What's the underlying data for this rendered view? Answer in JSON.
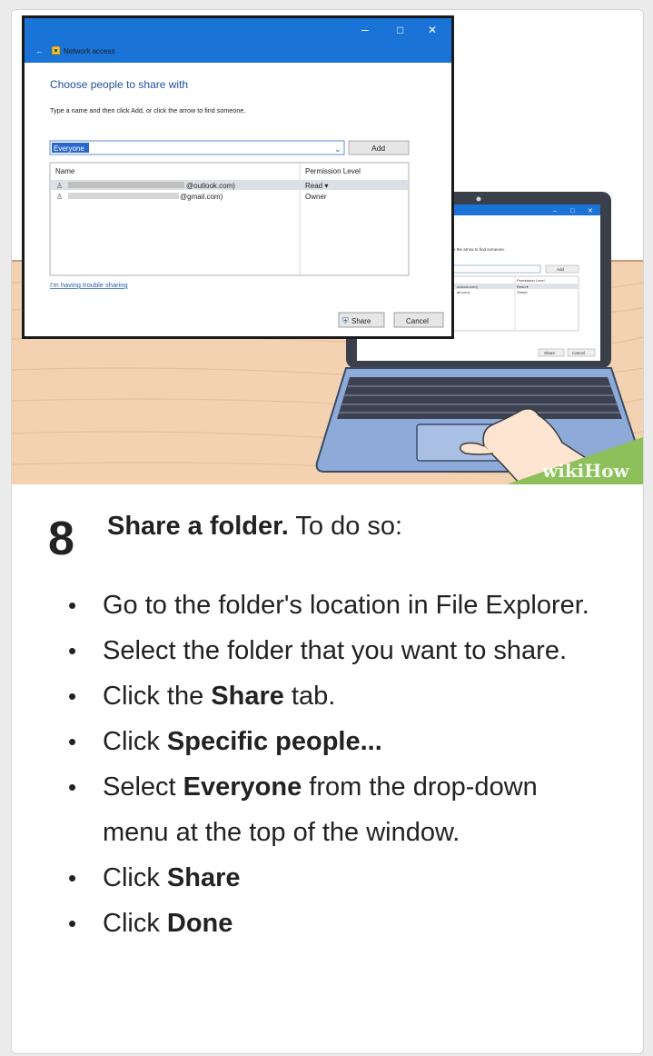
{
  "illustration": {
    "dialog": {
      "title": "Network access",
      "heading": "Choose people to share with",
      "instruction": "Type a name and then click Add, or click the arrow to find someone.",
      "input_value": "Everyone",
      "add_button": "Add",
      "columns": [
        "Name",
        "Permission Level"
      ],
      "rows": [
        {
          "name": "@outlook.com)",
          "permission": "Read ▾"
        },
        {
          "name": "@gmail.com)",
          "permission": "Owner"
        }
      ],
      "trouble_link": "I'm having trouble sharing",
      "share_button": "Share",
      "cancel_button": "Cancel",
      "window_controls": [
        "–",
        "□",
        "✕"
      ]
    },
    "laptop_screen": {
      "instruction_fragment": "e the arrow to find someone.",
      "columns": [
        "Permission Level"
      ],
      "rows": [
        {
          "name": "outlook.com)",
          "permission": "Read ▾"
        },
        {
          "name": "ail.com)",
          "permission": "Owner"
        }
      ],
      "add_button": "Add",
      "share_button": "Share",
      "cancel_button": "Cancel"
    },
    "watermark": "wikiHow",
    "colors": {
      "titlebar": "#1a73d6",
      "wall": "#ffffff",
      "floor": "#f2d0b0",
      "laptop_body": "#8fa8d6",
      "watermark_bg": "#8dbf5a"
    }
  },
  "step": {
    "number": "8",
    "title": "Share a folder.",
    "lead": "To do so:",
    "bullets": [
      {
        "text": "Go to the folder's location in File Explorer.",
        "pre": "",
        "bold": "",
        "post": ""
      },
      {
        "text": "Select the folder that you want to share.",
        "pre": "",
        "bold": "",
        "post": ""
      },
      {
        "pre": "Click the ",
        "bold": "Share",
        "post": " tab."
      },
      {
        "pre": "Click ",
        "bold": "Specific people...",
        "post": ""
      },
      {
        "pre": "Select ",
        "bold": "Everyone",
        "post": " from the drop-down menu at the top of the window."
      },
      {
        "pre": "Click ",
        "bold": "Share",
        "post": ""
      },
      {
        "pre": "Click ",
        "bold": "Done",
        "post": ""
      }
    ]
  }
}
